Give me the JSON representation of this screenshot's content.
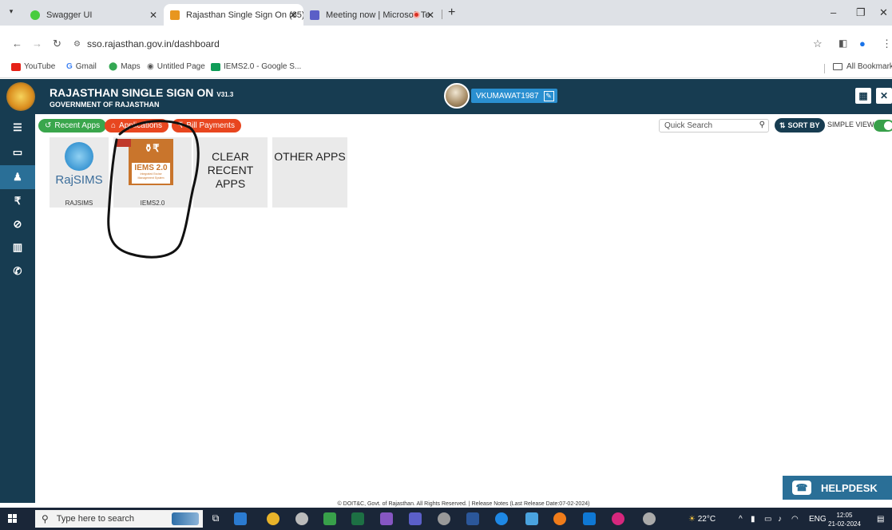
{
  "browser": {
    "tabs": [
      {
        "label": "Swagger UI",
        "active": false
      },
      {
        "label": "Rajasthan Single Sign On (85)",
        "active": true
      },
      {
        "label": "Meeting now | Microsoft Te",
        "active": false
      }
    ],
    "url": "sso.rajasthan.gov.in/dashboard",
    "bookmarks": [
      {
        "label": "YouTube",
        "color": "#e62117"
      },
      {
        "label": "Gmail",
        "color": "#4285f4"
      },
      {
        "label": "Maps",
        "color": "#34a853"
      },
      {
        "label": "Untitled Page",
        "color": "#555555"
      },
      {
        "label": "IEMS2.0 - Google S...",
        "color": "#0f9d58"
      }
    ],
    "all_bookmarks": "All Bookmarks"
  },
  "header": {
    "title": "RAJASTHAN SINGLE SIGN ON",
    "version": "V31.3",
    "subtitle": "GOVERNMENT OF RAJASTHAN",
    "username": "VKUMAWAT1987"
  },
  "toolbar": {
    "recent_apps": "Recent Apps",
    "applications": "Applications",
    "bill_payments": "Bill Payments",
    "quick_search_placeholder": "Quick Search",
    "sort_by": "SORT BY",
    "simple_view": "SIMPLE VIEW"
  },
  "apps": {
    "rajsims_logo_text": "RajSIMS",
    "rajsims_caption": "RAJSIMS",
    "iems_logo_text": "IEMS 2.0",
    "iems_logo_sub": "Integrated Excise Management System",
    "iems_caption": "IEMS2.0",
    "clear_recent": "CLEAR RECENT APPS",
    "other_apps": "OTHER APPS"
  },
  "footer": {
    "text": "© DOIT&C, Govt. of Rajasthan. All Rights Reserved. | Release Notes (Last Release Date:07-02-2024)",
    "helpdesk": "HELPDESK"
  },
  "taskbar": {
    "search_placeholder": "Type here to search",
    "weather": "22°C",
    "language": "ENG",
    "time": "12:05",
    "date": "21-02-2024"
  },
  "colors": {
    "header_bg": "#173c51",
    "pill_green": "#3aa64c",
    "pill_red": "#e8461f",
    "user_blue": "#2a8fd0",
    "toggle_green": "#38a04a"
  }
}
